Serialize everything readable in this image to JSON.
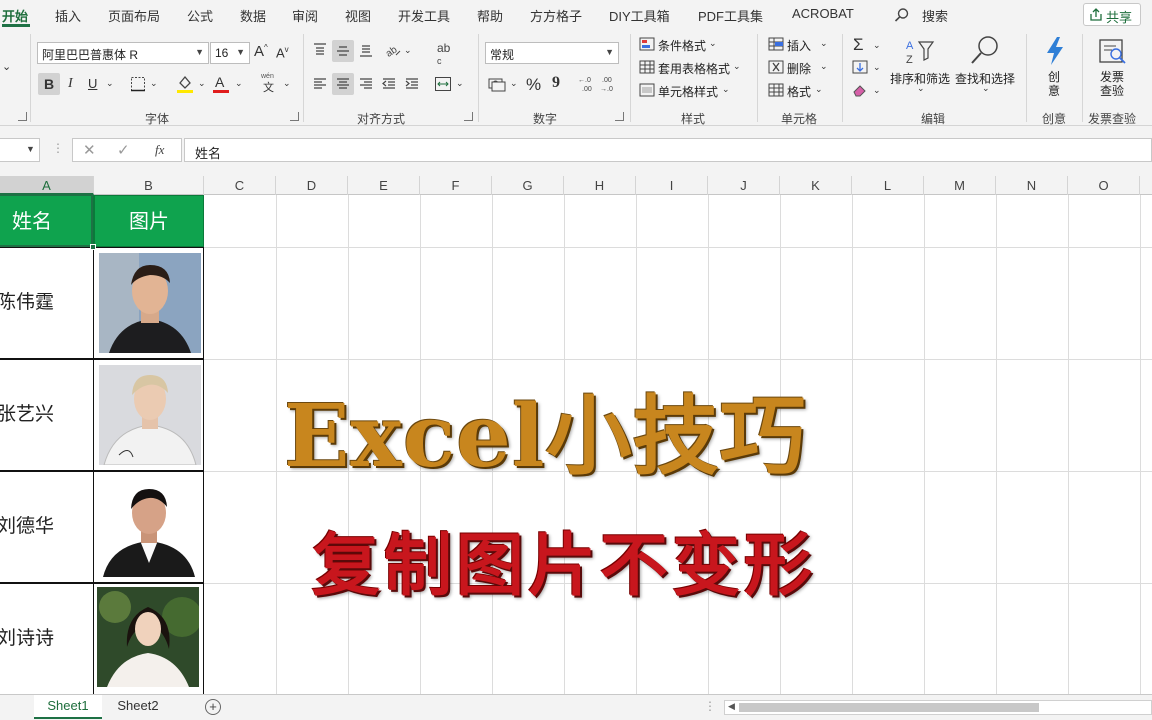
{
  "tabs": [
    "开始",
    "插入",
    "页面布局",
    "公式",
    "数据",
    "审阅",
    "视图",
    "开发工具",
    "帮助",
    "方方格子",
    "DIY工具箱",
    "PDF工具集",
    "ACROBAT"
  ],
  "search_label": "搜索",
  "share_label": "共享",
  "font": {
    "name": "阿里巴巴普惠体 R",
    "size": "16",
    "bold": "B",
    "italic": "I",
    "underline": "U",
    "phonetic_top": "wén",
    "phonetic_bottom": "文",
    "group": "字体"
  },
  "alignment": {
    "wrap": "ab",
    "wrap2": "c",
    "group": "对齐方式"
  },
  "number": {
    "format": "常规",
    "percent": "%",
    "comma": "9",
    "group": "数字"
  },
  "styles": {
    "conditional": "条件格式",
    "table": "套用表格格式",
    "cell": "单元格样式",
    "group": "样式"
  },
  "cells": {
    "insert": "插入",
    "delete": "删除",
    "format": "格式",
    "group": "单元格"
  },
  "editing": {
    "sort": "排序和筛选",
    "find": "查找和选择",
    "group": "编辑"
  },
  "creative": {
    "label_top": "创",
    "label_bottom": "意",
    "group": "创意"
  },
  "invoice": {
    "label_top": "发票",
    "label_bottom": "查验",
    "group": "发票查验"
  },
  "formula": {
    "fx": "fx",
    "value": "姓名"
  },
  "columns": [
    "A",
    "B",
    "C",
    "D",
    "E",
    "F",
    "G",
    "H",
    "I",
    "J",
    "K",
    "L",
    "M",
    "N",
    "O"
  ],
  "table": {
    "header_name": "姓名",
    "header_photo": "图片",
    "rows": [
      {
        "name": "陈伟霆"
      },
      {
        "name": "张艺兴"
      },
      {
        "name": "刘德华"
      },
      {
        "name": "刘诗诗"
      }
    ]
  },
  "overlay": {
    "title": "Excel小技巧",
    "subtitle": "复制图片不变形"
  },
  "sheets": [
    "Sheet1",
    "Sheet2"
  ],
  "colors": {
    "accent": "#1e7145",
    "header_fill": "#0fa34e",
    "title": "#c8861e",
    "subtitle": "#c8161d"
  }
}
